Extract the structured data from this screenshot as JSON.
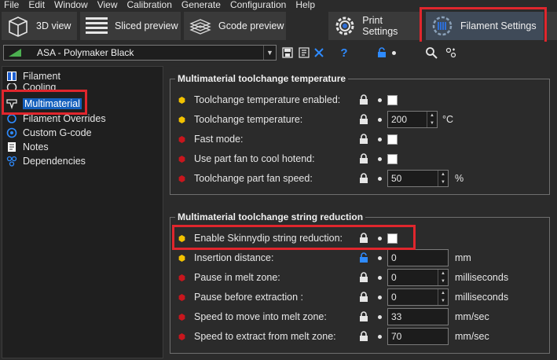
{
  "menu": [
    "File",
    "Edit",
    "Window",
    "View",
    "Calibration",
    "Generate",
    "Configuration",
    "Help"
  ],
  "tabs": {
    "view3d": "3D view",
    "sliced": "Sliced preview",
    "gcode": "Gcode preview",
    "print": "Print Settings",
    "filament": "Filament Settings"
  },
  "preset": {
    "name": "ASA - Polymaker Black",
    "flag_color": "#4caf50"
  },
  "tree": {
    "filament": "Filament",
    "cooling": "Cooling",
    "multimaterial": "Multimaterial",
    "overrides": "Filament Overrides",
    "gcode": "Custom G-code",
    "notes": "Notes",
    "dependencies": "Dependencies"
  },
  "groups": {
    "temp": {
      "title": "Multimaterial toolchange temperature",
      "rows": [
        {
          "label": "Toolchange temperature enabled:",
          "bullet": "yellow"
        },
        {
          "label": "Toolchange temperature:",
          "bullet": "yellow",
          "value": "200",
          "unit": "°C"
        },
        {
          "label": "Fast mode:",
          "bullet": "red"
        },
        {
          "label": "Use part fan to cool hotend:",
          "bullet": "red"
        },
        {
          "label": "Toolchange part fan speed:",
          "bullet": "red",
          "value": "50",
          "unit": "%"
        }
      ]
    },
    "string": {
      "title": "Multimaterial toolchange string reduction",
      "rows": [
        {
          "label": "Enable Skinnydip string reduction:",
          "bullet": "yellow"
        },
        {
          "label": "Insertion distance:",
          "bullet": "yellow",
          "value": "0",
          "unit": "mm"
        },
        {
          "label": "Pause in melt zone:",
          "bullet": "red",
          "value": "0",
          "unit": "milliseconds"
        },
        {
          "label": "Pause before extraction :",
          "bullet": "red",
          "value": "0",
          "unit": "milliseconds"
        },
        {
          "label": "Speed to move into melt zone:",
          "bullet": "red",
          "value": "33",
          "unit": "mm/sec"
        },
        {
          "label": "Speed to extract from melt zone:",
          "bullet": "red",
          "value": "70",
          "unit": "mm/sec"
        }
      ]
    }
  },
  "colors": {
    "highlight": "#e0262d",
    "selection": "#1560bd",
    "bullet_yellow": "#f2c200",
    "bullet_red": "#c8161d",
    "lock_blue": "#1e90ff"
  }
}
